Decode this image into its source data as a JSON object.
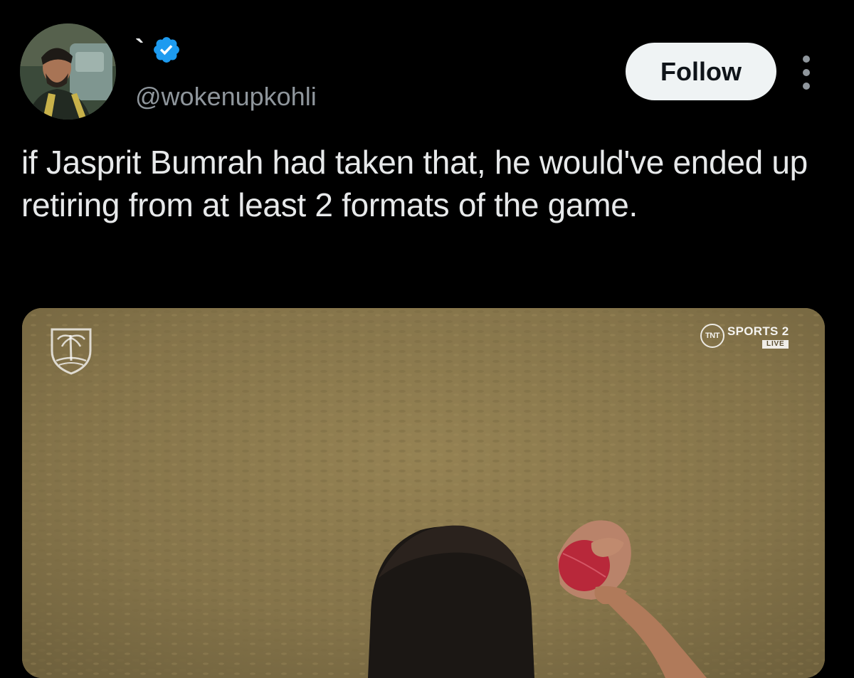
{
  "tweet": {
    "display_name": "`",
    "verified_icon": "verified-badge-icon",
    "handle": "@wokenupkohli",
    "follow_label": "Follow",
    "more_icon": "more-vertical-icon",
    "text": "if Jasprit Bumrah had taken that, he would've ended up retiring from at least 2 formats of the game."
  },
  "media": {
    "broadcaster_logo": {
      "badge": "TNT",
      "channel": "SPORTS 2",
      "status": "LIVE"
    },
    "team_logo_icon": "west-indies-cricket-crest-icon"
  },
  "colors": {
    "background": "#000000",
    "text_primary": "#e7e9ea",
    "text_secondary": "#8f969c",
    "verified_blue": "#1d9bf0",
    "follow_button_bg": "#eff3f4",
    "follow_button_text": "#0f1419",
    "grass": "#8c7a4c",
    "ball_red": "#b8283a"
  }
}
